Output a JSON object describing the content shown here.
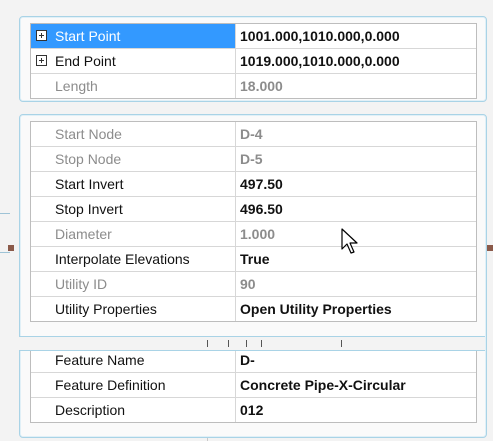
{
  "geometry": [
    {
      "label": "Start Point",
      "value": "1001.000,1010.000,0.000",
      "expandable": true,
      "selected": true,
      "readonly": false
    },
    {
      "label": "End Point",
      "value": "1019.000,1010.000,0.000",
      "expandable": true,
      "selected": false,
      "readonly": false
    },
    {
      "label": "Length",
      "value": "18.000",
      "expandable": false,
      "selected": false,
      "readonly": true
    }
  ],
  "pipe": [
    {
      "label": "Start Node",
      "value": "D-4",
      "readonly": true
    },
    {
      "label": "Stop Node",
      "value": "D-5",
      "readonly": true
    },
    {
      "label": "Start Invert",
      "value": "497.50",
      "readonly": false
    },
    {
      "label": "Stop Invert",
      "value": "496.50",
      "readonly": false
    },
    {
      "label": "Diameter",
      "value": "1.000",
      "readonly": true
    },
    {
      "label": "Interpolate Elevations",
      "value": "True",
      "readonly": false
    },
    {
      "label": "Utility ID",
      "value": "90",
      "readonly": true
    },
    {
      "label": "Utility Properties",
      "value": "Open Utility Properties",
      "readonly": false
    }
  ],
  "feature": [
    {
      "label": "Feature Name",
      "value": "D-",
      "readonly": false
    },
    {
      "label": "Feature Definition",
      "value": "Concrete Pipe-X-Circular",
      "readonly": false
    },
    {
      "label": "Description",
      "value": "012",
      "readonly": false
    }
  ],
  "colors": {
    "selection": "#3399ff",
    "panel_border": "#a9d3e6",
    "readonly_text": "#8c8c8c"
  },
  "icons": [
    "plus-expander-icon",
    "mouse-pointer-icon"
  ]
}
